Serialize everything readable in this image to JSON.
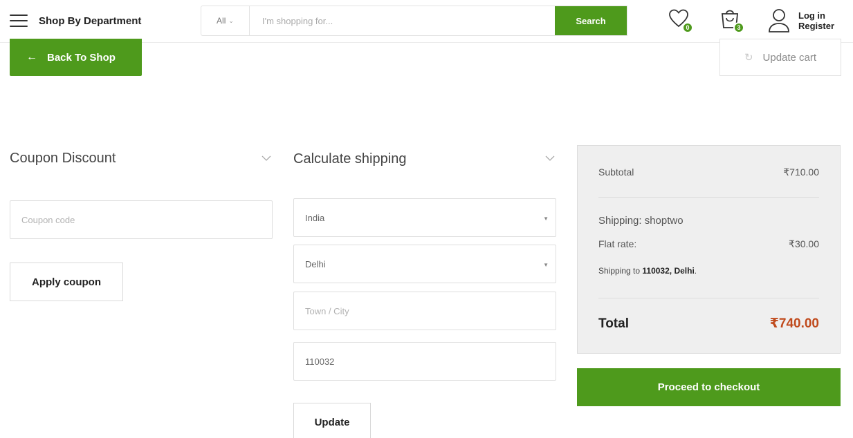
{
  "header": {
    "department_label": "Shop By Department",
    "search": {
      "category": "All",
      "placeholder": "I'm shopping for...",
      "button_label": "Search"
    },
    "wishlist_count": "0",
    "cart_count": "3",
    "account": {
      "login_label": "Log in",
      "register_label": "Register"
    }
  },
  "actions": {
    "back_label": "Back To Shop",
    "update_cart_label": "Update cart"
  },
  "coupon": {
    "title": "Coupon Discount",
    "placeholder": "Coupon code",
    "apply_label": "Apply coupon"
  },
  "shipping_calc": {
    "title": "Calculate shipping",
    "country": "India",
    "state": "Delhi",
    "city_placeholder": "Town / City",
    "postcode": "110032",
    "update_label": "Update"
  },
  "totals": {
    "subtotal_label": "Subtotal",
    "subtotal_value": "₹710.00",
    "shipping_label": "Shipping: shoptwo",
    "flat_rate_label": "Flat rate:",
    "flat_rate_value": "₹30.00",
    "shipping_to_prefix": "Shipping to ",
    "shipping_to_location": "110032, Delhi",
    "shipping_to_suffix": ".",
    "total_label": "Total",
    "total_value": "₹740.00",
    "checkout_label": "Proceed to checkout"
  },
  "colors": {
    "accent_green": "#4e9a1c",
    "total_red": "#c04a1c",
    "panel_grey": "#efefef"
  }
}
